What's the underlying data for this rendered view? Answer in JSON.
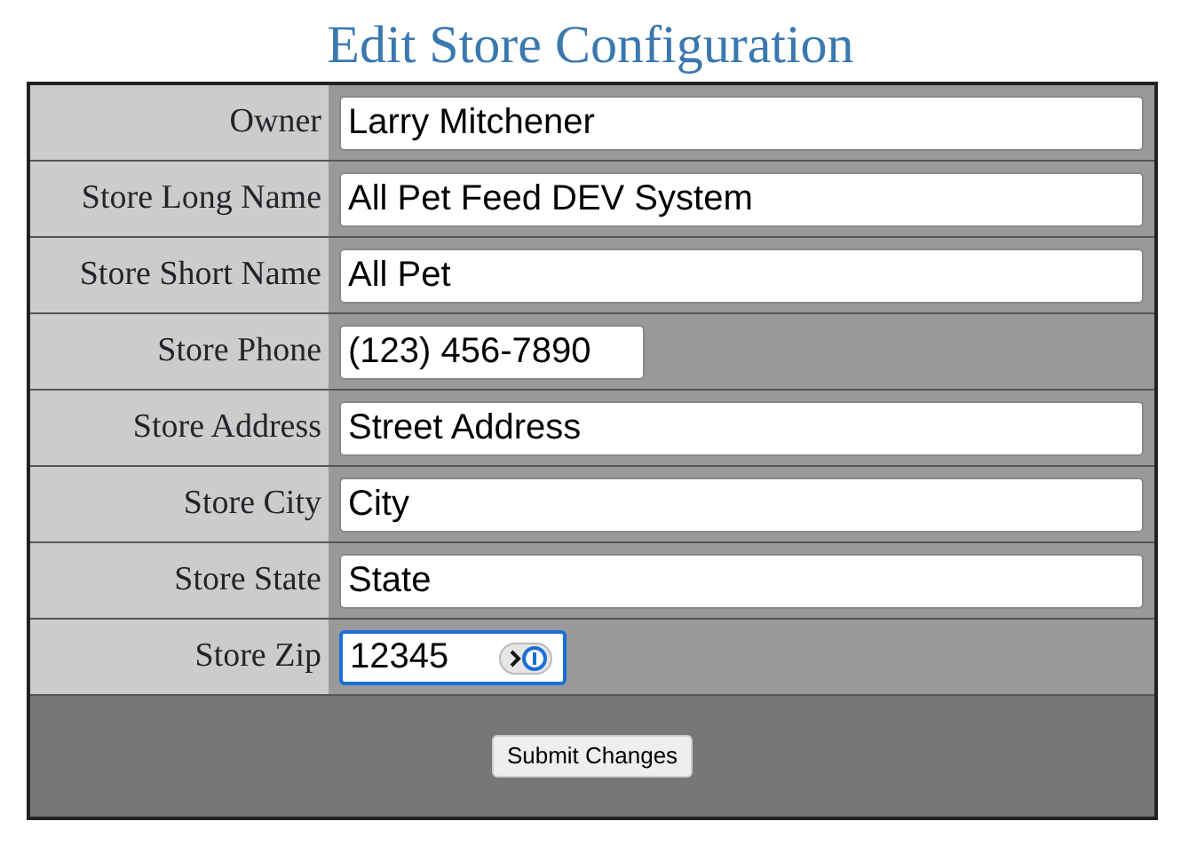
{
  "title": "Edit Store Configuration",
  "fields": [
    {
      "label": "Owner",
      "value": "Larry Mitchener",
      "kind": "wide",
      "focused": false
    },
    {
      "label": "Store Long Name",
      "value": "All Pet Feed DEV System",
      "kind": "wide",
      "focused": false
    },
    {
      "label": "Store Short Name",
      "value": "All Pet",
      "kind": "wide",
      "focused": false
    },
    {
      "label": "Store Phone",
      "value": "(123) 456-7890",
      "kind": "short",
      "focused": false
    },
    {
      "label": "Store Address",
      "value": "Street Address",
      "kind": "wide",
      "focused": false
    },
    {
      "label": "Store City",
      "value": "City",
      "kind": "wide",
      "focused": false
    },
    {
      "label": "Store State",
      "value": "State",
      "kind": "wide",
      "focused": false
    },
    {
      "label": "Store Zip",
      "value": "12345",
      "kind": "zip",
      "focused": true
    }
  ],
  "submit": "Submit Changes"
}
